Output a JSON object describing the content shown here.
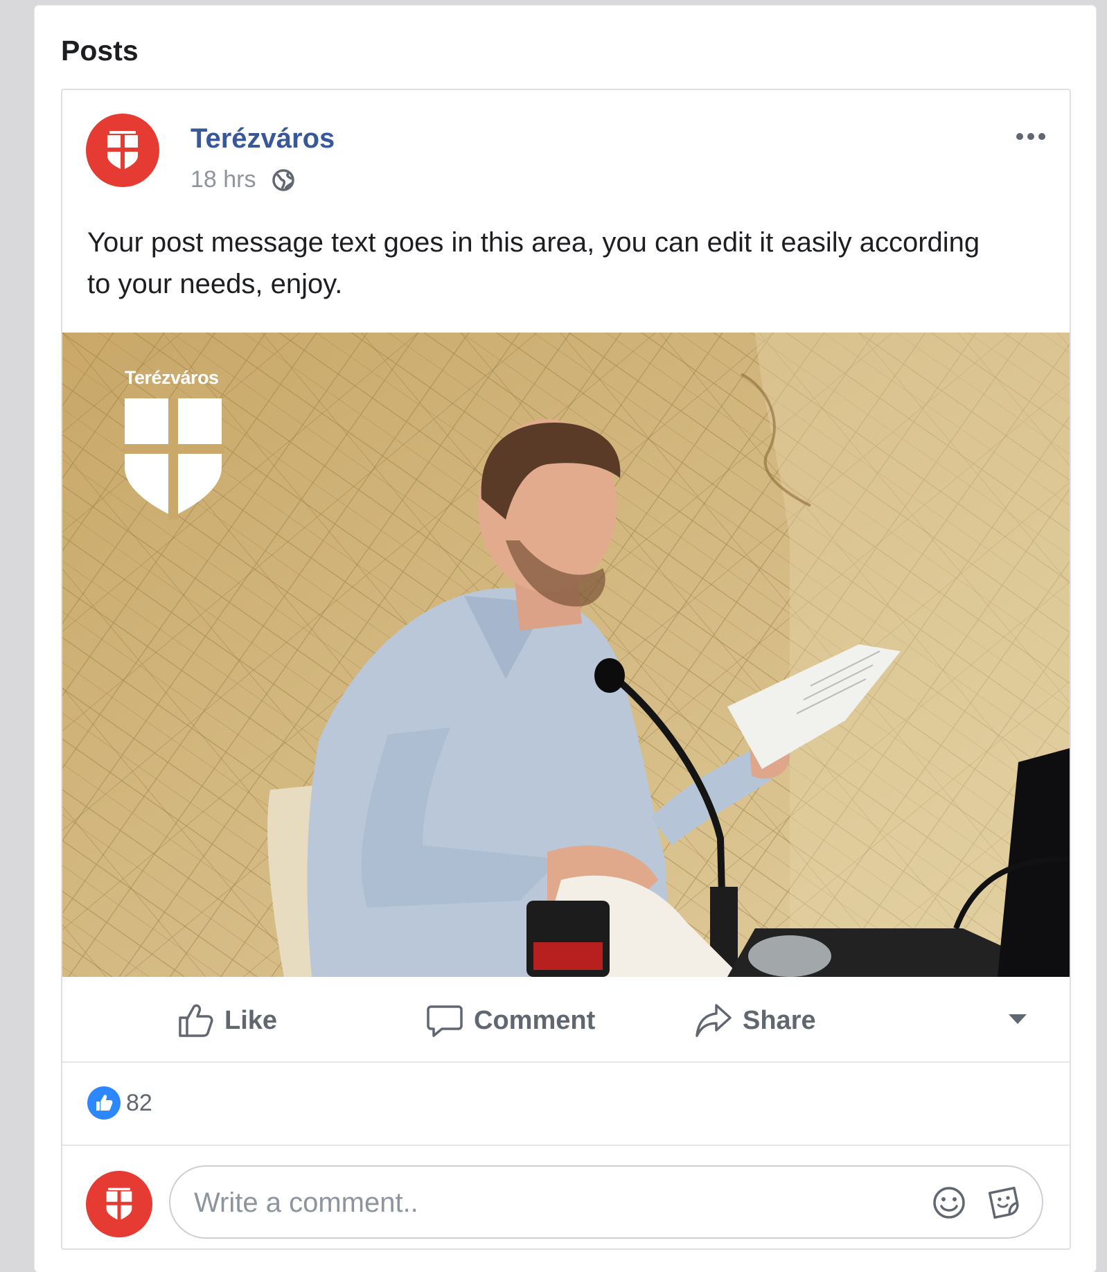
{
  "panel": {
    "title": "Posts"
  },
  "post": {
    "page_name": "Terézváros",
    "time": "18 hrs",
    "privacy_icon": "globe-icon",
    "message": "Your post message text goes in this area, you can edit it easily according to your needs, enjoy.",
    "image_brand": "Terézváros"
  },
  "actions": {
    "like_label": "Like",
    "comment_label": "Comment",
    "share_label": "Share"
  },
  "reactions": {
    "count": "82"
  },
  "comment": {
    "placeholder": "Write a comment.."
  },
  "colors": {
    "brand_red": "#e53b33",
    "link_blue": "#385898",
    "like_blue": "#2d88ff",
    "secondary_text": "#90949c"
  }
}
